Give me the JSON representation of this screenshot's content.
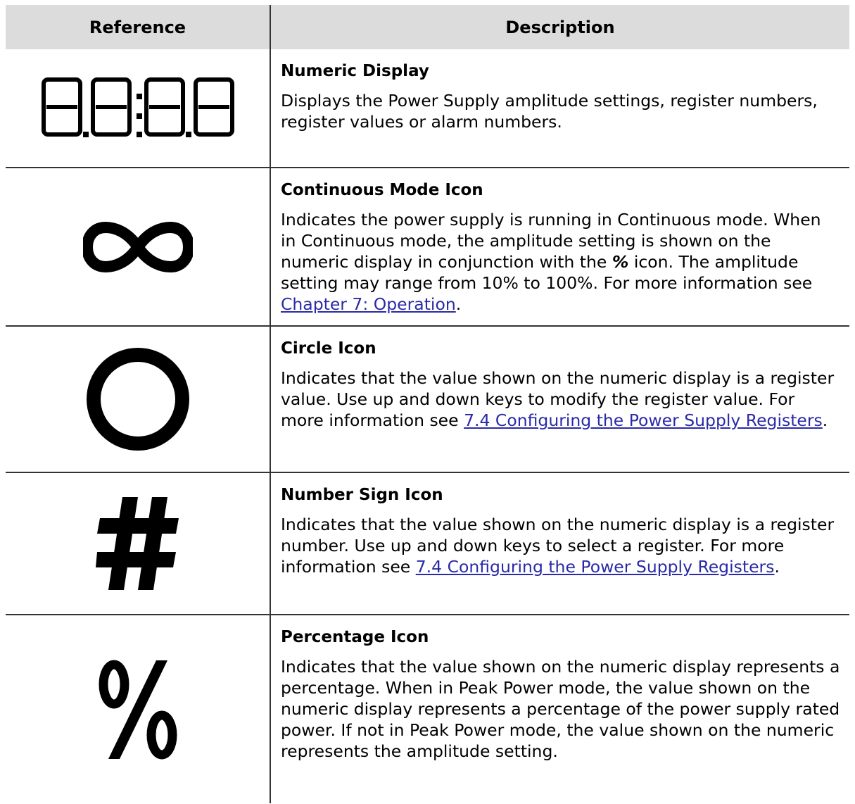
{
  "table": {
    "headers": {
      "reference": "Reference",
      "description": "Description"
    },
    "rows": [
      {
        "icon": "seven-segment-display-icon",
        "title": "Numeric Display",
        "body": "Displays the Power Supply amplitude settings, register numbers, register values or alarm numbers."
      },
      {
        "icon": "infinity-icon",
        "title": "Continuous Mode Icon",
        "body_part1": "Indicates the power supply is running in Continuous mode. When in Continuous mode, the amplitude setting is shown on the numeric display in conjunction with the ",
        "body_symbol": "%",
        "body_part2": " icon. The amplitude setting may range from 10% to 100%. For more information see ",
        "link": "Chapter 7: Operation",
        "body_end": "."
      },
      {
        "icon": "circle-icon",
        "title": "Circle Icon",
        "body": "Indicates that the value shown on the numeric display is a register value. Use up and down keys to modify the register value. For more information see ",
        "link": "7.4 Configuring the Power Supply Registers",
        "body_end": "."
      },
      {
        "icon": "number-sign-icon",
        "title": "Number Sign Icon",
        "body": "Indicates that the value shown on the numeric display is a register number. Use up and down keys to select a register. For more information see ",
        "link": "7.4 Configuring the Power Supply Registers",
        "body_end": "."
      },
      {
        "icon": "percent-icon",
        "title": "Percentage Icon",
        "body": "Indicates that the value shown on the numeric display represents a percentage. When in Peak Power mode, the value shown on the numeric display represents a percentage of the power supply rated power. If not in Peak Power mode, the value shown on the numeric represents the amplitude setting."
      }
    ]
  },
  "colors": {
    "header_bg": "#dcdcdc",
    "link": "#2a2aa8",
    "border": "#333333"
  }
}
